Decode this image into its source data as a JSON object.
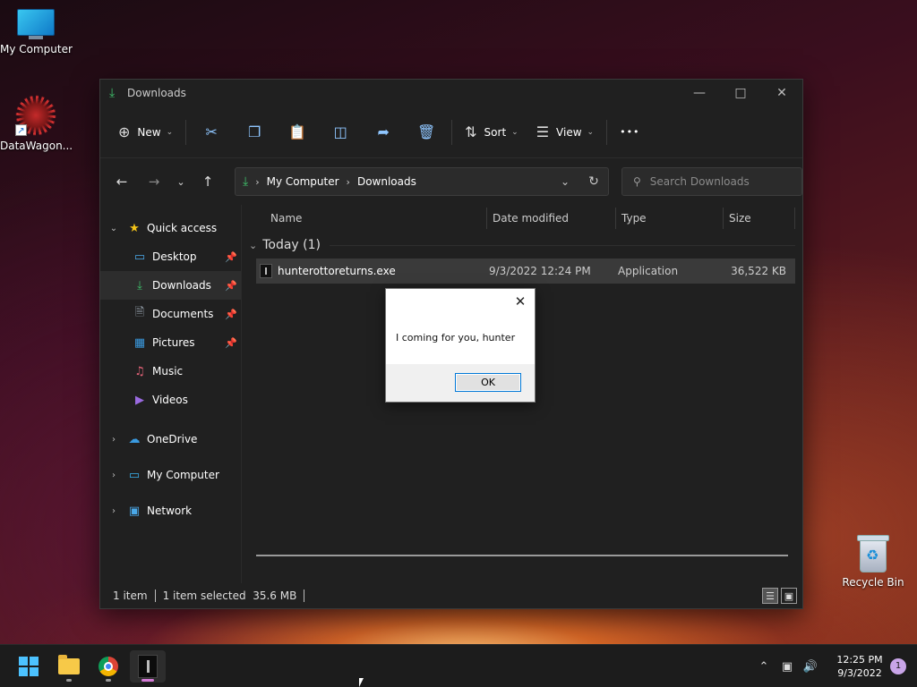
{
  "desktop": {
    "icons": [
      {
        "label": "My Computer"
      },
      {
        "label": "DataWagon..."
      },
      {
        "label": "Recycle Bin"
      }
    ]
  },
  "window": {
    "title": "Downloads",
    "toolbar": {
      "new_label": "New",
      "sort_label": "Sort",
      "view_label": "View",
      "more_label": "•••"
    },
    "address": {
      "crumbs": [
        "My Computer",
        "Downloads"
      ]
    },
    "search": {
      "placeholder": "Search Downloads"
    },
    "sidebar": {
      "quick_access": "Quick access",
      "items": [
        {
          "label": "Desktop",
          "pinned": true
        },
        {
          "label": "Downloads",
          "pinned": true,
          "selected": true
        },
        {
          "label": "Documents",
          "pinned": true
        },
        {
          "label": "Pictures",
          "pinned": true
        },
        {
          "label": "Music",
          "pinned": false
        },
        {
          "label": "Videos",
          "pinned": false
        }
      ],
      "roots": [
        {
          "label": "OneDrive"
        },
        {
          "label": "My Computer"
        },
        {
          "label": "Network"
        }
      ]
    },
    "columns": [
      "Name",
      "Date modified",
      "Type",
      "Size"
    ],
    "group_label": "Today (1)",
    "files": [
      {
        "name": "hunterottoreturns.exe",
        "date": "9/3/2022 12:24 PM",
        "type": "Application",
        "size": "36,522 KB"
      }
    ],
    "status": {
      "count": "1 item",
      "selected": "1 item selected  35.6 MB"
    }
  },
  "dialog": {
    "message": "I coming for you, hunter",
    "ok_label": "OK"
  },
  "taskbar": {
    "clock_time": "12:25 PM",
    "clock_date": "9/3/2022",
    "notification_count": "1"
  },
  "colors": {
    "accent": "#0078d7",
    "download_green": "#3fbf6a",
    "taskbar_active_indicator": "#d47ad6"
  }
}
